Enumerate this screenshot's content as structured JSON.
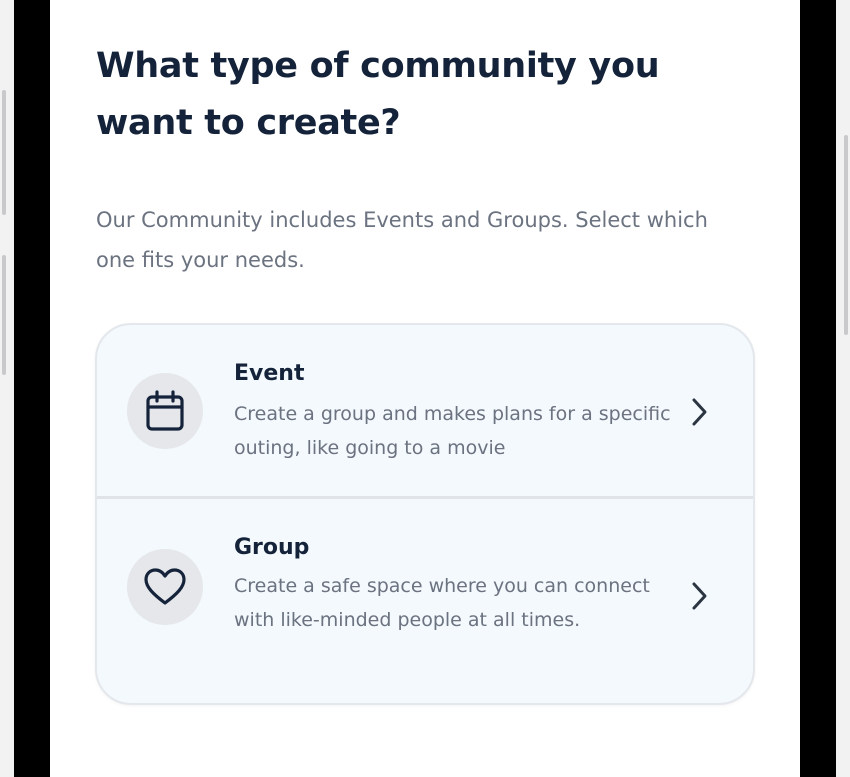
{
  "page": {
    "title": "What type of community you want to create?",
    "subtitle": "Our Community includes Events and Groups. Select which one fits your needs."
  },
  "options": [
    {
      "title": "Event",
      "description": "Create a group and makes plans for a specific outing, like going to a movie",
      "icon": "calendar-icon"
    },
    {
      "title": "Group",
      "description": "Create a safe space where you can connect with like-minded people at all times.",
      "icon": "heart-icon"
    }
  ],
  "colors": {
    "title_text": "#14233a",
    "body_text": "#6b7280",
    "card_background": "#f3f9fc",
    "icon_circle": "#e5e7eb",
    "bezel": "#000000"
  }
}
